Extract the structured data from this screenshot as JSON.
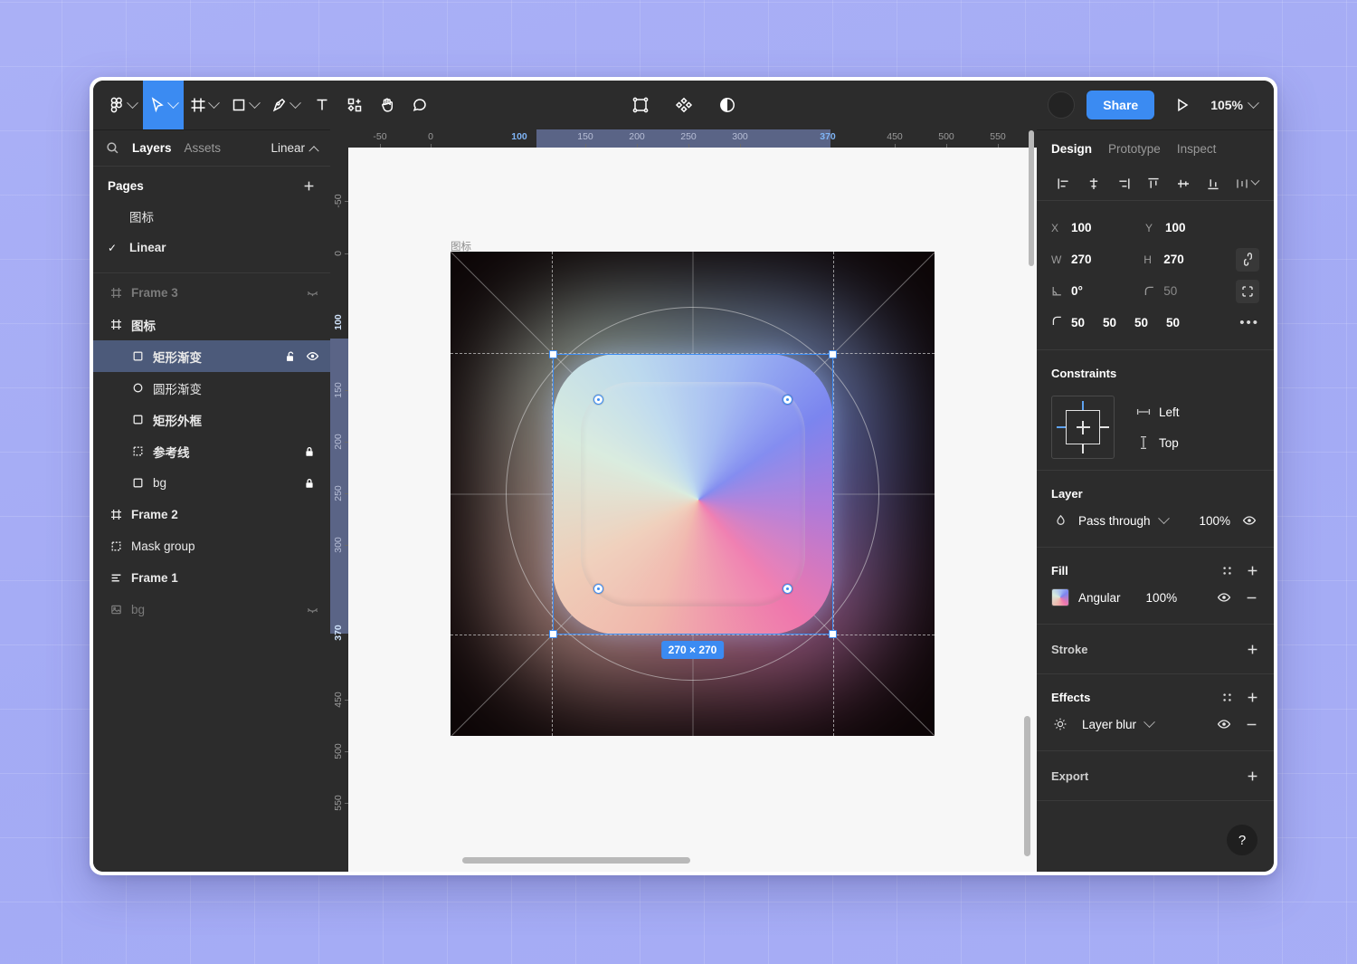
{
  "app": {
    "name": "Figma"
  },
  "toolbar": {
    "left_tools": [
      {
        "name": "figma-menu-icon",
        "label": "Figma menu",
        "caret": true,
        "active": false
      },
      {
        "name": "move-tool-icon",
        "label": "Move",
        "caret": true,
        "active": true
      },
      {
        "name": "frame-tool-icon",
        "label": "Frame",
        "caret": true,
        "active": false
      },
      {
        "name": "shape-tool-icon",
        "label": "Shape",
        "caret": true,
        "active": false
      },
      {
        "name": "pen-tool-icon",
        "label": "Pen",
        "caret": true,
        "active": false
      },
      {
        "name": "text-tool-icon",
        "label": "Text",
        "caret": false,
        "active": false
      },
      {
        "name": "components-tool-icon",
        "label": "Components",
        "caret": false,
        "active": false
      },
      {
        "name": "hand-tool-icon",
        "label": "Hand",
        "caret": false,
        "active": false
      },
      {
        "name": "comment-tool-icon",
        "label": "Comment",
        "caret": false,
        "active": false
      }
    ],
    "center_tools": [
      {
        "name": "selection-bounds-icon",
        "label": "Selection bounds"
      },
      {
        "name": "plugin-diamond-icon",
        "label": "Plugins"
      },
      {
        "name": "contrast-icon",
        "label": "Contrast"
      }
    ],
    "share_label": "Share",
    "present_icon": "play-icon",
    "zoom_level": "105%",
    "avatar": "user-avatar"
  },
  "left_panel": {
    "search_icon": "search-icon",
    "tabs": [
      {
        "label": "Layers",
        "active": true
      },
      {
        "label": "Assets",
        "active": false
      }
    ],
    "page_chip": "Linear",
    "pages_title": "Pages",
    "add_page_icon": "plus-icon",
    "pages": [
      {
        "label": "图标",
        "selected": false
      },
      {
        "label": "Linear",
        "selected": true
      }
    ],
    "layers": [
      {
        "label": "Frame 3",
        "icon": "frame-icon",
        "indent": 0,
        "bold": true,
        "dim": true,
        "selected": false,
        "hidden_icon": "eye-closed-icon",
        "locked": false
      },
      {
        "label": "图标",
        "icon": "frame-icon",
        "indent": 0,
        "bold": true,
        "dim": false,
        "selected": false,
        "hidden_icon": null,
        "locked": false
      },
      {
        "label": "矩形渐变",
        "icon": "rect-icon",
        "indent": 1,
        "bold": true,
        "dim": false,
        "selected": true,
        "hidden_icon": "eye-open-icon",
        "locked": false,
        "unlock_icon": "unlock-icon"
      },
      {
        "label": "圆形渐变",
        "icon": "ellipse-icon",
        "indent": 1,
        "bold": false,
        "dim": false,
        "selected": false,
        "hidden_icon": null,
        "locked": false
      },
      {
        "label": "矩形外框",
        "icon": "rect-icon",
        "indent": 1,
        "bold": true,
        "dim": false,
        "selected": false,
        "hidden_icon": null,
        "locked": false
      },
      {
        "label": "参考线",
        "icon": "group-icon",
        "indent": 1,
        "bold": true,
        "dim": false,
        "selected": false,
        "hidden_icon": null,
        "locked": true
      },
      {
        "label": "bg",
        "icon": "rect-icon",
        "indent": 1,
        "bold": false,
        "dim": false,
        "selected": false,
        "hidden_icon": null,
        "locked": true
      },
      {
        "label": "Frame 2",
        "icon": "frame-icon",
        "indent": 0,
        "bold": true,
        "dim": false,
        "selected": false,
        "hidden_icon": null,
        "locked": false
      },
      {
        "label": "Mask group",
        "icon": "group-icon",
        "indent": 0,
        "bold": false,
        "dim": false,
        "selected": false,
        "hidden_icon": null,
        "locked": false
      },
      {
        "label": "Frame 1",
        "icon": "autolayout-icon",
        "indent": 0,
        "bold": true,
        "dim": false,
        "selected": false,
        "hidden_icon": null,
        "locked": false
      },
      {
        "label": "bg",
        "icon": "image-icon",
        "indent": 0,
        "bold": false,
        "dim": true,
        "selected": false,
        "hidden_icon": "eye-closed-icon",
        "locked": false
      }
    ]
  },
  "rulers": {
    "horizontal_labels": [
      "-50",
      "0",
      "100",
      "150",
      "200",
      "250",
      "300",
      "370",
      "450",
      "500",
      "550"
    ],
    "vertical_labels": [
      "-50",
      "0",
      "100",
      "150",
      "200",
      "250",
      "300",
      "370",
      "450",
      "500",
      "550"
    ],
    "highlight_start": "100",
    "highlight_end": "370"
  },
  "canvas": {
    "artboard_label": "图标",
    "size_badge": "270 × 270"
  },
  "right_panel": {
    "tabs": [
      {
        "label": "Design",
        "active": true
      },
      {
        "label": "Prototype",
        "active": false
      },
      {
        "label": "Inspect",
        "active": false
      }
    ],
    "align_buttons": [
      "align-left-icon",
      "align-horizontal-center-icon",
      "align-right-icon",
      "align-top-icon",
      "align-vertical-center-icon",
      "align-bottom-icon",
      "distribute-icon"
    ],
    "position": {
      "x_label": "X",
      "x_value": "100",
      "y_label": "Y",
      "y_value": "100",
      "w_label": "W",
      "w_value": "270",
      "h_label": "H",
      "h_value": "270",
      "rotation_label": "rotation",
      "rotation_value": "0°",
      "corner_label": "corner",
      "corner_value": "50",
      "constrain_icon": "link-icon",
      "independent-corners-icon": "independent-corners-icon",
      "radii": [
        "50",
        "50",
        "50",
        "50"
      ],
      "more_icon": "more-dots-icon"
    },
    "constraints": {
      "title": "Constraints",
      "horizontal": "Left",
      "vertical": "Top",
      "horizontal_icon": "horizontal-constraint-icon",
      "vertical_icon": "vertical-constraint-icon"
    },
    "layer": {
      "title": "Layer",
      "blend_mode": "Pass through",
      "opacity": "100%",
      "blend_icon": "blend-mode-icon",
      "visibility_icon": "eye-open-icon"
    },
    "fill": {
      "title": "Fill",
      "type": "Angular",
      "opacity": "100%",
      "settings_icon": "style-dots-icon",
      "add_icon": "plus-icon",
      "visibility_icon": "eye-open-icon",
      "remove_icon": "minus-icon"
    },
    "stroke": {
      "title": "Stroke",
      "add_icon": "plus-icon"
    },
    "effects": {
      "title": "Effects",
      "item": "Layer blur",
      "item_icon": "blur-icon",
      "settings_icon": "style-dots-icon",
      "add_icon": "plus-icon",
      "visibility_icon": "eye-open-icon",
      "remove_icon": "minus-icon"
    },
    "export": {
      "title": "Export",
      "add_icon": "plus-icon"
    },
    "help_label": "?"
  },
  "colors": {
    "accent": "#3b8bf2",
    "panel_bg": "#2c2c2c",
    "canvas_bg": "#f7f7f7",
    "selection_row": "#4c5a7a",
    "ruler_highlight": "#5a6486",
    "desktop": "#a5acf5"
  }
}
